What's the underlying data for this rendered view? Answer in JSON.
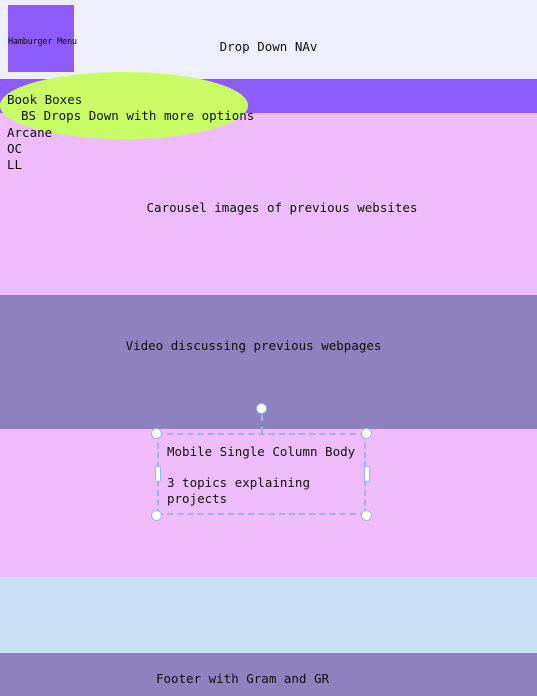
{
  "colors": {
    "nav_band": "#efeefc",
    "purple_band": "#8f5cfc",
    "hamburger_box": "#8f5cfc",
    "book_boxes_ellipse": "#c9fc64",
    "carousel_band": "#efbcfb",
    "video_band": "#8d81bf",
    "body_band": "#efbcfb",
    "light_blue_band": "#c9dff5",
    "footer_band": "#8d81bf",
    "selection": "#9fb4ec"
  },
  "nav": {
    "hamburger_label": "Hamburger Menu",
    "title": "Drop Down NAv"
  },
  "book_boxes": {
    "title": "Book Boxes",
    "subtitle": "BS Drops Down with more options",
    "items": [
      "Arcane",
      "OC",
      "LL"
    ]
  },
  "carousel": {
    "label": "Carousel images of previous websites"
  },
  "video": {
    "label": "Video discussing previous webpages"
  },
  "body_section": {
    "heading": "Mobile Single Column Body",
    "line1": "3 topics explaining",
    "line2": "projects"
  },
  "footer": {
    "label": "Footer with Gram and GR"
  }
}
